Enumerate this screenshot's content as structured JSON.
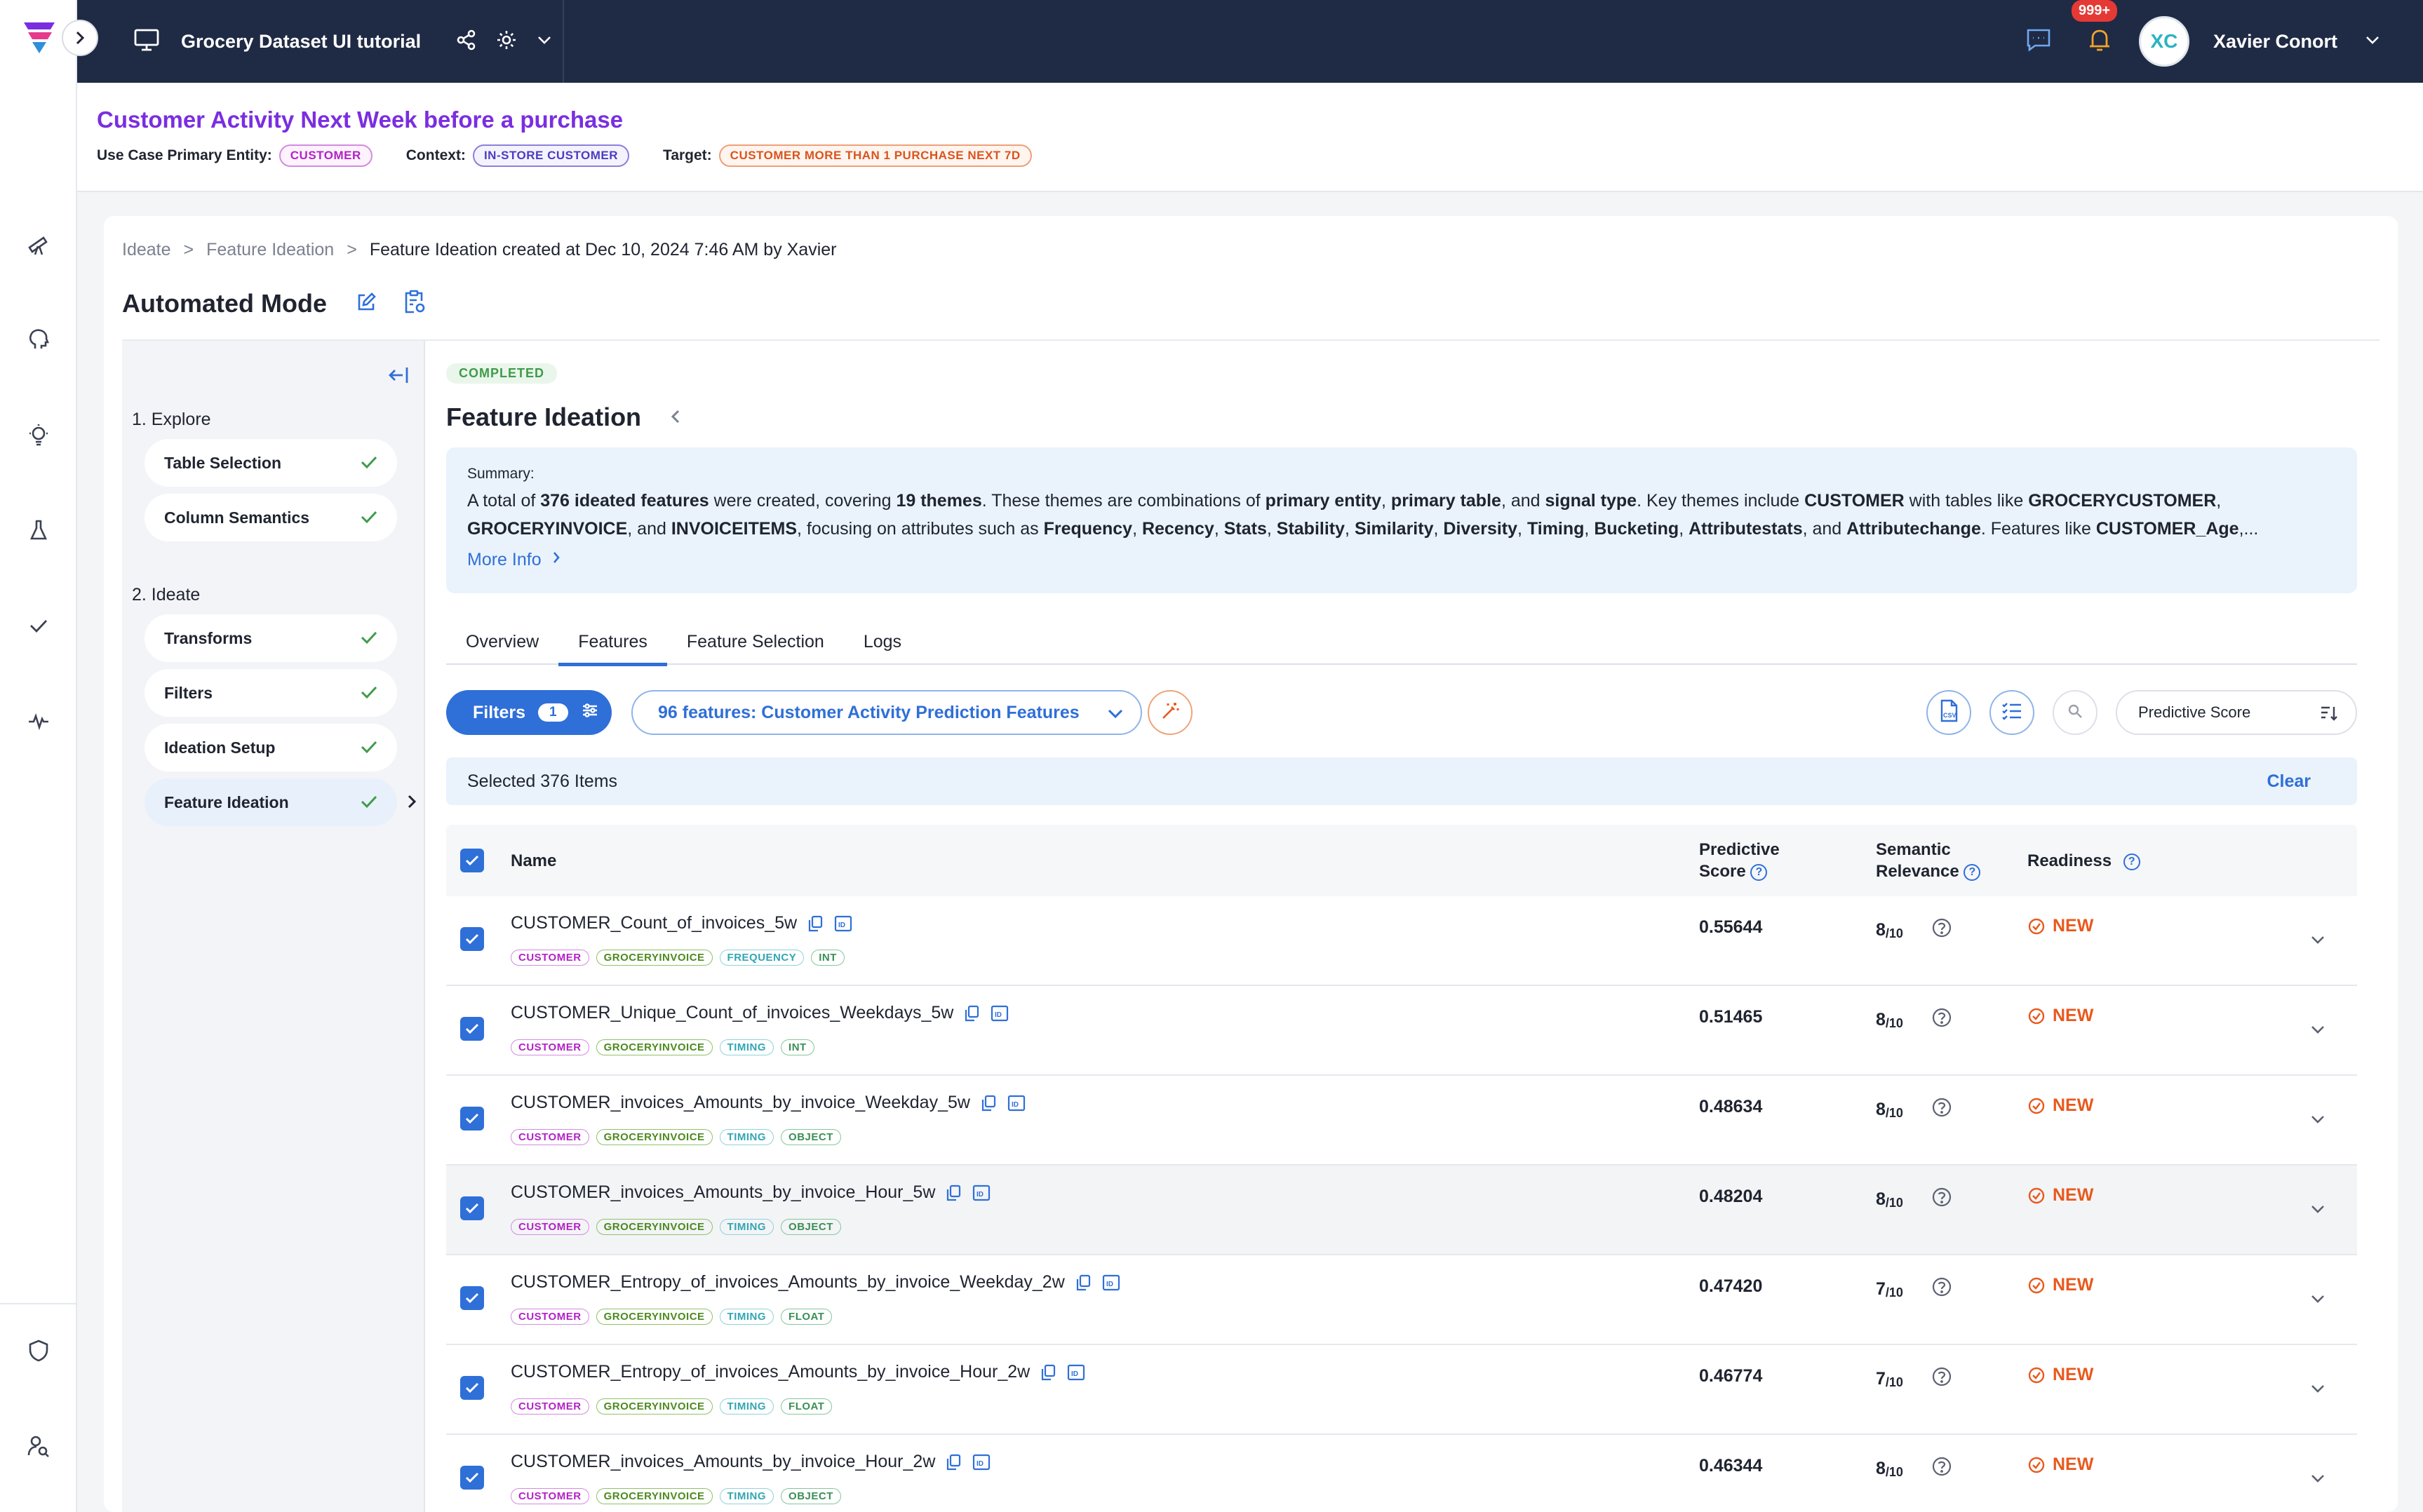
{
  "topbar": {
    "project_title": "Grocery Dataset UI tutorial",
    "notification_count": "999+",
    "user_initials": "XC",
    "user_name": "Xavier Conort"
  },
  "use_case": {
    "title": "Customer Activity Next Week before a purchase",
    "primary_entity_label": "Use Case Primary Entity:",
    "primary_entity": "CUSTOMER",
    "context_label": "Context:",
    "context": "IN-STORE CUSTOMER",
    "target_label": "Target:",
    "target": "CUSTOMER MORE THAN 1 PURCHASE NEXT 7D"
  },
  "breadcrumb": {
    "items": [
      "Ideate",
      "Feature Ideation",
      "Feature Ideation created at Dec 10, 2024 7:46 AM by Xavier"
    ],
    "separator": ">"
  },
  "mode_title": "Automated Mode",
  "steps": {
    "explore_heading": "1. Explore",
    "explore_items": [
      "Table Selection",
      "Column Semantics"
    ],
    "ideate_heading": "2. Ideate",
    "ideate_items": [
      "Transforms",
      "Filters",
      "Ideation Setup",
      "Feature Ideation"
    ]
  },
  "content": {
    "status": "COMPLETED",
    "title": "Feature Ideation",
    "summary_label": "Summary:",
    "more_info": "More Info"
  },
  "tabs": [
    "Overview",
    "Features",
    "Feature Selection",
    "Logs"
  ],
  "toolbar": {
    "filters_label": "Filters",
    "filters_count": "1",
    "feature_set": "96 features: Customer Activity Prediction Features",
    "sort_label": "Predictive Score"
  },
  "selection": {
    "text": "Selected 376 Items",
    "clear": "Clear"
  },
  "table": {
    "headers": {
      "name": "Name",
      "predictive_line1": "Predictive",
      "predictive_line2": "Score",
      "semantic_line1": "Semantic",
      "semantic_line2": "Relevance",
      "readiness": "Readiness"
    },
    "rows": [
      {
        "name": "CUSTOMER_Count_of_invoices_5w",
        "tags": [
          "CUSTOMER",
          "GROCERYINVOICE",
          "FREQUENCY",
          "INT"
        ],
        "score": "0.55644",
        "relevance": "8",
        "relevance_den": "/10",
        "readiness": "NEW"
      },
      {
        "name": "CUSTOMER_Unique_Count_of_invoices_Weekdays_5w",
        "tags": [
          "CUSTOMER",
          "GROCERYINVOICE",
          "TIMING",
          "INT"
        ],
        "score": "0.51465",
        "relevance": "8",
        "relevance_den": "/10",
        "readiness": "NEW"
      },
      {
        "name": "CUSTOMER_invoices_Amounts_by_invoice_Weekday_5w",
        "tags": [
          "CUSTOMER",
          "GROCERYINVOICE",
          "TIMING",
          "OBJECT"
        ],
        "score": "0.48634",
        "relevance": "8",
        "relevance_den": "/10",
        "readiness": "NEW"
      },
      {
        "name": "CUSTOMER_invoices_Amounts_by_invoice_Hour_5w",
        "tags": [
          "CUSTOMER",
          "GROCERYINVOICE",
          "TIMING",
          "OBJECT"
        ],
        "score": "0.48204",
        "relevance": "8",
        "relevance_den": "/10",
        "readiness": "NEW"
      },
      {
        "name": "CUSTOMER_Entropy_of_invoices_Amounts_by_invoice_Weekday_2w",
        "tags": [
          "CUSTOMER",
          "GROCERYINVOICE",
          "TIMING",
          "FLOAT"
        ],
        "score": "0.47420",
        "relevance": "7",
        "relevance_den": "/10",
        "readiness": "NEW"
      },
      {
        "name": "CUSTOMER_Entropy_of_invoices_Amounts_by_invoice_Hour_2w",
        "tags": [
          "CUSTOMER",
          "GROCERYINVOICE",
          "TIMING",
          "FLOAT"
        ],
        "score": "0.46774",
        "relevance": "7",
        "relevance_den": "/10",
        "readiness": "NEW"
      },
      {
        "name": "CUSTOMER_invoices_Amounts_by_invoice_Hour_2w",
        "tags": [
          "CUSTOMER",
          "GROCERYINVOICE",
          "TIMING",
          "OBJECT"
        ],
        "score": "0.46344",
        "relevance": "8",
        "relevance_den": "/10",
        "readiness": "NEW"
      }
    ]
  },
  "colors": {
    "topbar": "#1f2a44",
    "accent": "#2f6fd8",
    "title_purple": "#7a2ee0",
    "ready_orange": "#e8591d",
    "done_green": "#3f9b4a"
  }
}
